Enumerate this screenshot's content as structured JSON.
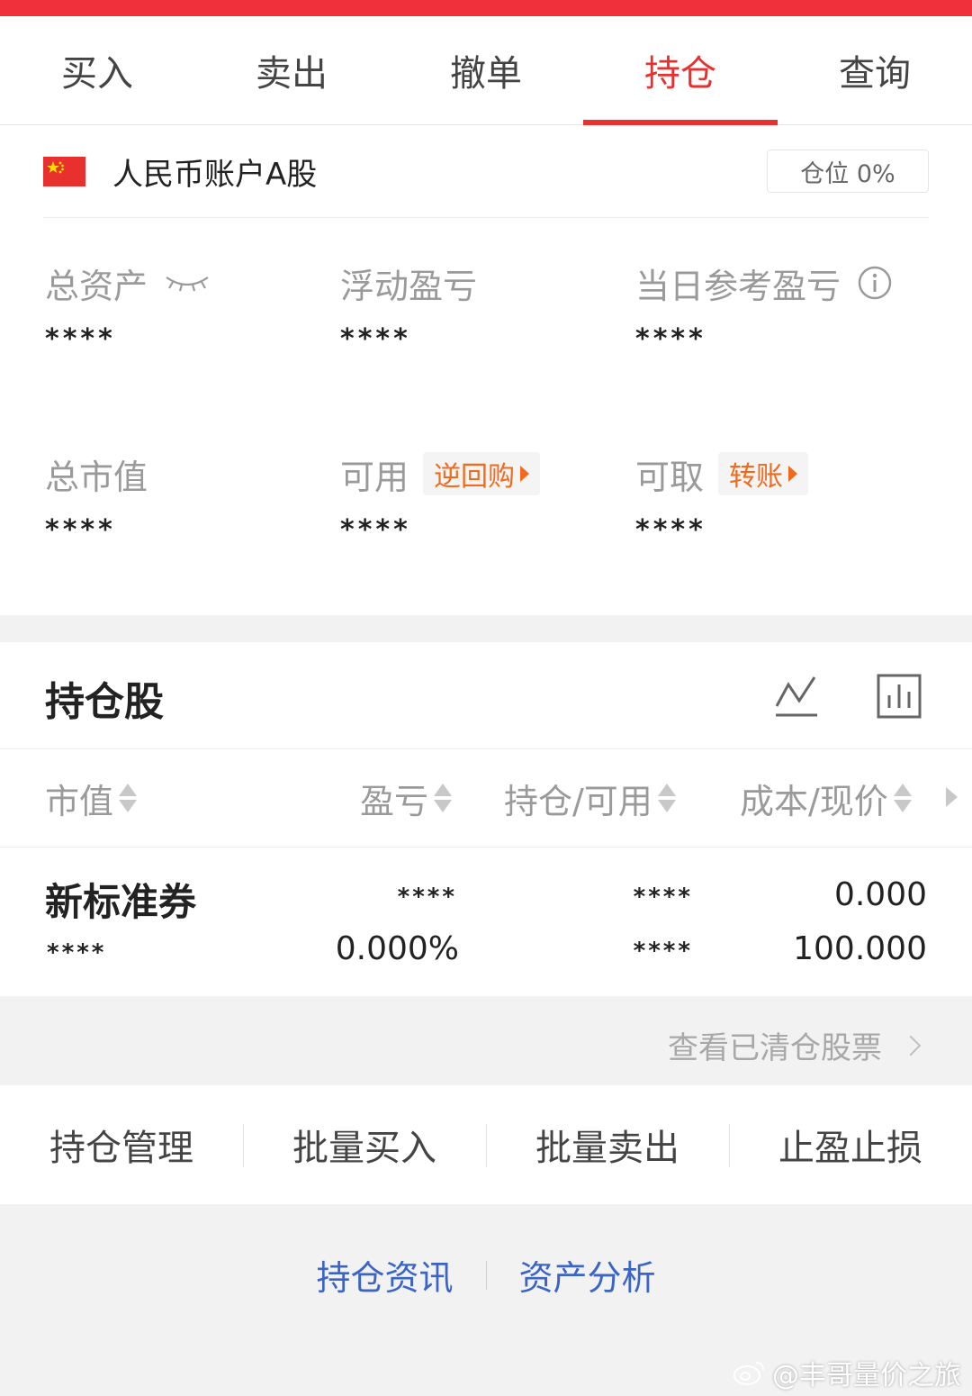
{
  "tabs": [
    {
      "label": "买入",
      "active": false
    },
    {
      "label": "卖出",
      "active": false
    },
    {
      "label": "撤单",
      "active": false
    },
    {
      "label": "持仓",
      "active": true
    },
    {
      "label": "查询",
      "active": false
    }
  ],
  "account": {
    "name": "人民币账户A股",
    "position_label": "仓位 0%",
    "metrics": {
      "total_assets": {
        "label": "总资产",
        "value": "****"
      },
      "floating_pl": {
        "label": "浮动盈亏",
        "value": "****"
      },
      "daily_pl": {
        "label": "当日参考盈亏",
        "value": "****"
      },
      "market_value": {
        "label": "总市值",
        "value": "****"
      },
      "available": {
        "label": "可用",
        "value": "****",
        "chip": "逆回购"
      },
      "withdrawable": {
        "label": "可取",
        "value": "****",
        "chip": "转账"
      }
    }
  },
  "holdings": {
    "title": "持仓股",
    "columns": [
      "市值",
      "盈亏",
      "持仓/可用",
      "成本/现价"
    ],
    "rows": [
      {
        "name": "新标准券",
        "market_value": "****",
        "pl": "****",
        "pl_pct": "0.000%",
        "position": "****",
        "available": "****",
        "cost": "0.000",
        "price": "100.000"
      }
    ]
  },
  "view_cleared": "查看已清仓股票",
  "actions": [
    "持仓管理",
    "批量买入",
    "批量卖出",
    "止盈止损"
  ],
  "links": [
    "持仓资讯",
    "资产分析"
  ],
  "watermark": "@丰哥量价之旅",
  "colors": {
    "accent": "#e8302f",
    "orange": "#f26a1b",
    "link": "#3a64c6"
  }
}
